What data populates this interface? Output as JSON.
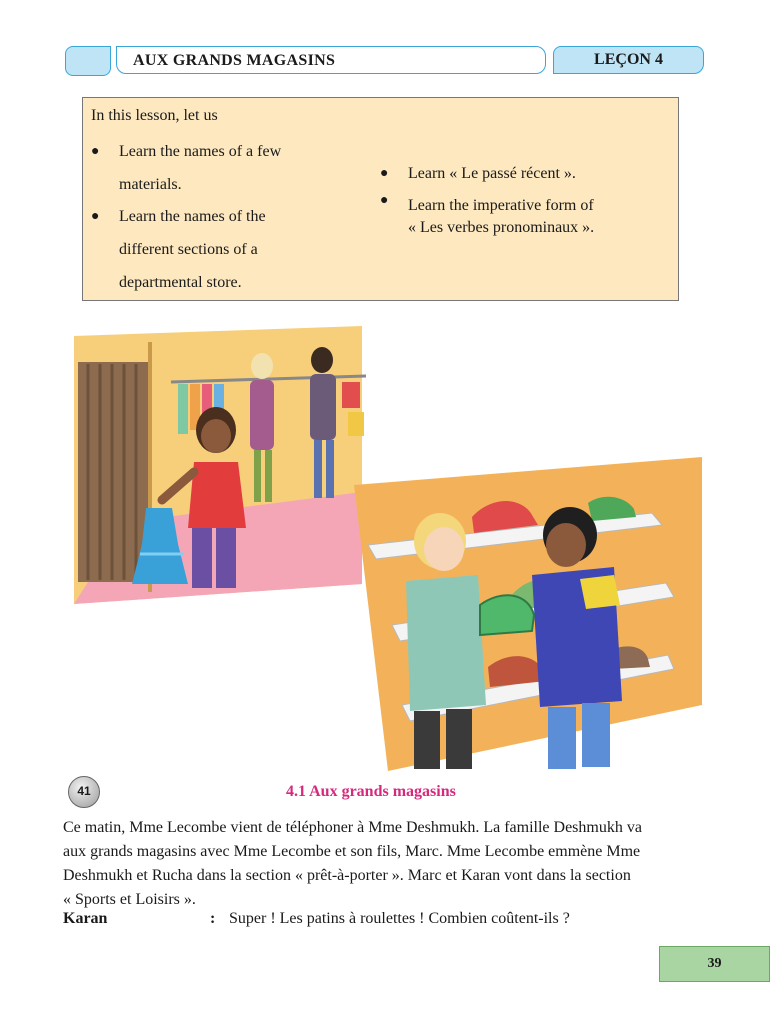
{
  "header": {
    "title": "AUX  GRANDS  MAGASINS",
    "lesson": "LEÇON 4"
  },
  "objectives": {
    "intro": "In this lesson, let us",
    "bullet_symbol": "●",
    "left": [
      [
        "Learn the names of  a few",
        "materials."
      ],
      [
        "Learn the names of  the",
        "different sections of a",
        "departmental store."
      ]
    ],
    "right": [
      [
        "Learn « Le passé récent »."
      ],
      [
        "Learn the imperative form of",
        "« Les verbes pronominaux »."
      ]
    ]
  },
  "audio_track": "41",
  "section_title": "4.1  Aux grands magasins",
  "paragraph_lines": [
    "Ce matin, Mme Lecombe vient de téléphoner à Mme Deshmukh. La famille Deshmukh va",
    "aux grands magasins avec Mme Lecombe et son fils, Marc. Mme Lecombe emmène Mme",
    "Deshmukh et Rucha dans la section « prêt-à-porter ». Marc et Karan vont dans la section",
    "« Sports et Loisirs »."
  ],
  "dialogue": {
    "speaker": "Karan",
    "colon": ":",
    "line": "Super ! Les patins à roulettes ! Combien coûtent-ils ?"
  },
  "page_number": "39",
  "colors": {
    "header_fill": "#bfe4f5",
    "header_border": "#3aa6d8",
    "objectives_fill": "#fde8c0",
    "section_title": "#d6287d",
    "page_number_fill": "#a8d5a2"
  }
}
